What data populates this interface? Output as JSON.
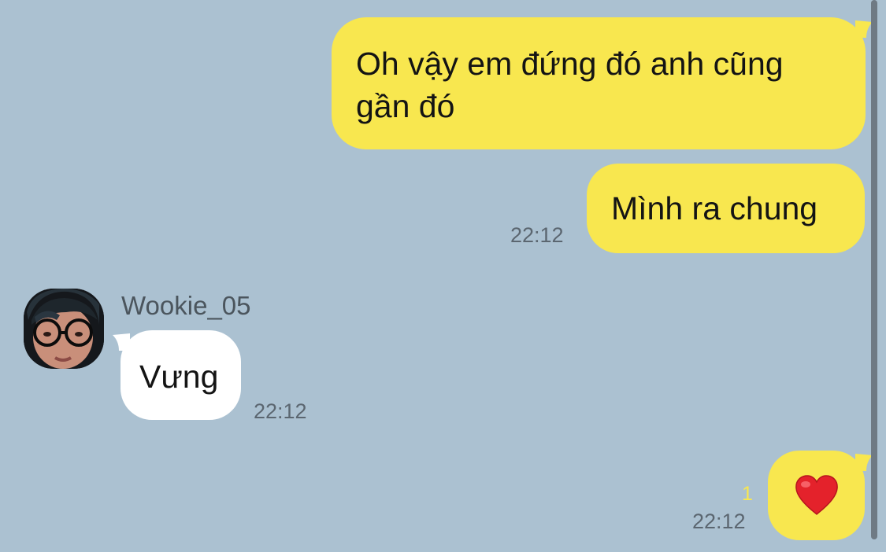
{
  "colors": {
    "background": "#abc1d1",
    "my_bubble": "#f8e74f",
    "other_bubble": "#ffffff",
    "timestamp": "#5b6670",
    "unread_count": "#f8e74f"
  },
  "messages": [
    {
      "from": "me",
      "line1": "Oh vậy em đứng đó anh cũng",
      "line2": "gần đó"
    },
    {
      "from": "me",
      "text": "Mình ra chung",
      "time": "22:12"
    },
    {
      "from": "other",
      "sender": "Wookie_05",
      "text": "Vưng",
      "time": "22:12"
    },
    {
      "from": "me",
      "icon": "red-heart-emoji",
      "unread": "1",
      "time": "22:12"
    }
  ]
}
